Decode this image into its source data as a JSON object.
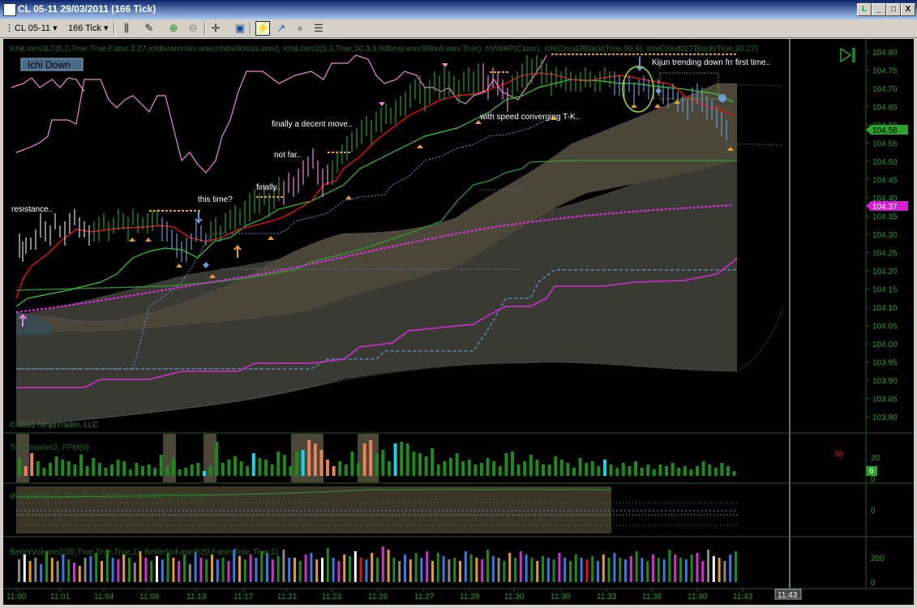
{
  "window": {
    "title": "CL 05-11  29/03/2011 (166 Tick)",
    "buttons": [
      "L",
      "_",
      "□",
      "X"
    ]
  },
  "toolbar": {
    "instrument": "CL 05-11",
    "interval": "166 Tick"
  },
  "colors": {
    "background": "#000000",
    "kijun": "#e01818",
    "tenkan": "#38c838",
    "lagging": "#e98ad6",
    "vwap": "#d030d0",
    "cloud_bull": "#4a4638",
    "cloud_bear": "#3a4a52",
    "axis_grid": "#1e5a1e",
    "axis_text": "#2e9a2e",
    "price_marker": "#2ea02e",
    "vwap_marker": "#d020d0"
  },
  "price_panel": {
    "indicator_label": "IchiLines3LT(5,2,True,True,False,3,27,ichibearcross.wav,ichibullcross.wav), IchiLines3(5,2,True,10,3,9,90bear.wav,90bull.wav,True), hVWAP(Close), IchiCloud3Black(True,50,9), IchiCloud3LTBlack(True,30,27)",
    "badge": "Ichi Down",
    "copyright": "© 2011 NinjaTrader, LLC",
    "price_marker": "104.58",
    "vwap_marker": "104.37",
    "annotations": [
      "resistance..",
      "this time?",
      "finally..",
      "not far..",
      "finally a decent move..",
      "with speed converging T-K..",
      "Kijun trending down frr first time.."
    ]
  },
  "tick_panel": {
    "label": "TickCounter2, FPM(6)",
    "counter": "98",
    "marker": "6",
    "axis_labels": [
      "20",
      "0"
    ]
  },
  "skew_panel": {
    "label": "dValueSkew(1,True,True,10,30,0.7,2,VWTPO,7,300,1)",
    "axis_labels": [
      "0"
    ]
  },
  "volume_panel": {
    "label": "BetterVolume2(20,True,True,True,1), BetterVolume2(20,False,True,True,1)",
    "axis_labels": [
      "200",
      "0"
    ]
  },
  "time_axis": {
    "labels": [
      "11:00",
      "11:01",
      "11:04",
      "11:08",
      "11:13",
      "11:17",
      "11:21",
      "11:23",
      "11:26",
      "11:27",
      "11:29",
      "11:30",
      "11:30",
      "11:33",
      "11:36",
      "11:40",
      "11:43"
    ],
    "cursor_time": "11:43"
  },
  "chart_data": {
    "type": "line",
    "title": "CL 05-11  29/03/2011 (166 Tick)",
    "xlabel": "",
    "ylabel": "",
    "ylim": [
      103.78,
      104.82
    ],
    "y_ticks": [
      "104.80",
      "104.75",
      "104.70",
      "104.65",
      "104.60",
      "104.55",
      "104.50",
      "104.45",
      "104.40",
      "104.35",
      "104.30",
      "104.25",
      "104.20",
      "104.15",
      "104.10",
      "104.05",
      "104.00",
      "103.95",
      "103.90",
      "103.85",
      "103.80"
    ],
    "x_labels": [
      "11:00",
      "11:01",
      "11:04",
      "11:08",
      "11:13",
      "11:17",
      "11:21",
      "11:23",
      "11:26",
      "11:27",
      "11:29",
      "11:30",
      "11:30",
      "11:33",
      "11:36",
      "11:40",
      "11:43"
    ],
    "series": [
      {
        "values": [
          104.15,
          104.29,
          104.32,
          104.31,
          104.33,
          104.31,
          104.35,
          104.29,
          104.27,
          104.33,
          104.31,
          104.35,
          104.38,
          104.4,
          104.47,
          104.5,
          104.49,
          104.47,
          104.52,
          104.56,
          104.64,
          104.66,
          104.7,
          104.72,
          104.71,
          104.74,
          104.77,
          104.7,
          104.62,
          104.66,
          104.62,
          104.58
        ]
      },
      {
        "values": [
          104.14,
          104.25,
          104.3,
          104.32,
          104.32,
          104.33,
          104.33,
          104.32,
          104.3,
          104.3,
          104.32,
          104.34,
          104.38,
          104.4,
          104.44,
          104.5,
          104.54,
          104.58,
          104.61,
          104.63,
          104.64,
          104.65,
          104.68,
          104.71,
          104.73,
          104.71,
          104.7,
          104.69,
          104.66,
          104.63,
          104.64,
          104.62
        ]
      },
      {
        "values": [
          104.16,
          104.2,
          104.22,
          104.24,
          104.24,
          104.24,
          104.24,
          104.24,
          104.27,
          104.3,
          104.34,
          104.36,
          104.4,
          104.44,
          104.46,
          104.5,
          104.52,
          104.56,
          104.58,
          104.6,
          104.62,
          104.64,
          104.68,
          104.7,
          104.7,
          104.7,
          104.7,
          104.7,
          104.7,
          104.7,
          104.7,
          104.7
        ]
      },
      {
        "values": [
          104.1,
          104.11,
          104.12,
          104.13,
          104.14,
          104.15,
          104.16,
          104.17,
          104.18,
          104.19,
          104.2,
          104.21,
          104.22,
          104.23,
          104.24,
          104.26,
          104.27,
          104.28,
          104.29,
          104.3,
          104.31,
          104.32,
          104.33,
          104.34,
          104.35,
          104.35,
          104.36,
          104.36,
          104.37,
          104.37,
          104.37,
          104.37
        ]
      }
    ]
  }
}
